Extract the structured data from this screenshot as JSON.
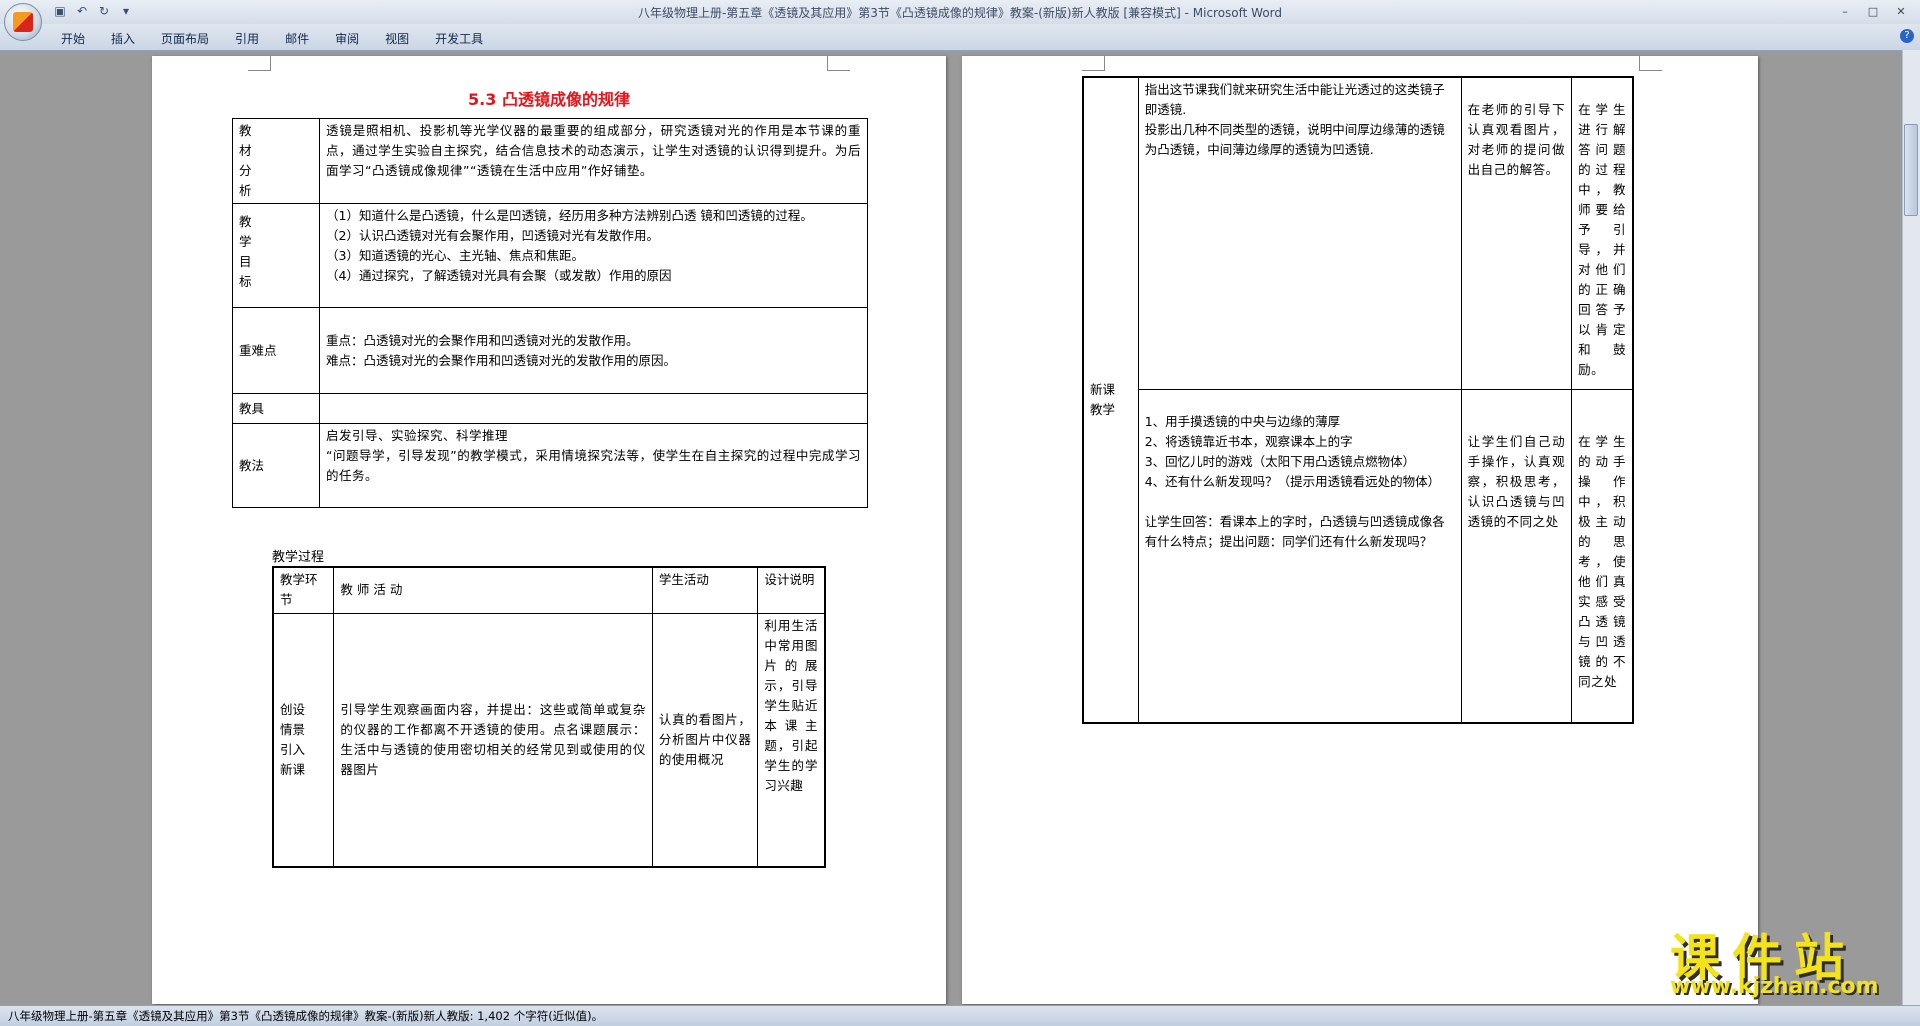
{
  "window": {
    "title": "八年级物理上册-第五章《透镜及其应用》第3节《凸透镜成像的规律》教案-(新版)新人教版 [兼容模式] - Microsoft Word"
  },
  "ribbon": {
    "tabs": [
      "开始",
      "插入",
      "页面布局",
      "引用",
      "邮件",
      "审阅",
      "视图",
      "开发工具"
    ]
  },
  "doc": {
    "title": "5.3  凸透镜成像的规律",
    "info_table": [
      {
        "label": "教材分析",
        "content": [
          "透镜是照相机、投影机等光学仪器的最重要的组成部分，研究透镜对光的作用是本节课的重点，通过学生实验自主探究，结合信息技术的动态演示，让学生对透镜的认识得到提升。为后面学习“凸透镜成像规律”“透镜在生活中应用”作好铺垫。"
        ]
      },
      {
        "label": "教学目标",
        "content": [
          "（1）知道什么是凸透镜，什么是凹透镜，经历用多种方法辨别凸透 镜和凹透镜的过程。",
          "（2）认识凸透镜对光有会聚作用，凹透镜对光有发散作用。",
          "（3）知道透镜的光心、主光轴、焦点和焦距。",
          "（4）通过探究，了解透镜对光具有会聚（或发散）作用的原因"
        ]
      },
      {
        "label": "重难点",
        "content": [
          "重点：凸透镜对光的会聚作用和凹透镜对光的发散作用。",
          "难点：凸透镜对光的会聚作用和凹透镜对光的发散作用的原因。"
        ]
      },
      {
        "label": "教具",
        "content": [
          ""
        ]
      },
      {
        "label": "教法",
        "content": [
          "启发引导、实验探究、科学推理",
          "“问题导学，引导发现”的教学模式，采用情境探究法等，使学生在自主探究的过程中完成学习的任务。"
        ]
      }
    ],
    "process_label": "教学过程",
    "process_table": {
      "headers": [
        "教学环节",
        "教 师 活 动",
        "学生活动",
        "设计说明"
      ],
      "rows": [
        {
          "stage": "创设情景引入新课",
          "teacher": "引导学生观察画面内容，并提出：这些或简单或复杂的仪器的工作都离不开透镜的使用。点名课题展示：生活中与透镜的使用密切相关的经常见到或使用的仪器图片",
          "student": "认真的看图片，分析图片中仪器的使用概况",
          "design": "利用生活中常用图片的展示，引导学生贴近本课主题，引起学生的学习兴趣"
        }
      ]
    },
    "process_table_cont": {
      "stage": "新课教学",
      "rows": [
        {
          "teacher": [
            "指出这节课我们就来研究生活中能让光透过的这类镜子即透镜.",
            "投影出几种不同类型的透镜，说明中间厚边缘薄的透镜为凸透镜，中间薄边缘厚的透镜为凹透镜."
          ],
          "student": "在老师的引导下认真观看图片，对老师的提问做出自己的解答。",
          "design": "在学生进行解答问题的过程中，教师要给予引导，并对他们的正确回答予以肯定和鼓励。"
        },
        {
          "teacher": [
            "1、用手摸透镜的中央与边缘的薄厚",
            "2、将透镜靠近书本，观察课本上的字",
            "3、回忆儿时的游戏（太阳下用凸透镜点燃物体）",
            "4、还有什么新发现吗？（提示用透镜看远处的物体）",
            "让学生回答：看课本上的字时，凸透镜与凹透镜成像各有什么特点；提出问题：同学们还有什么新发现吗？"
          ],
          "student": "让学生们自己动手操作，认真观察，积极思考，认识凸透镜与凹透镜的不同之处",
          "design": "在学生的动手操作中，积极主动的思考，使他们真实感受凸透镜与凹透镜的不同之处"
        }
      ]
    }
  },
  "statusbar": {
    "text": "八年级物理上册-第五章《透镜及其应用》第3节《凸透镜成像的规律》教案-(新版)新人教版: 1,402 个字符(近似值)。"
  },
  "watermark": {
    "main": "课件站",
    "url": "www.kjzhan.com"
  }
}
